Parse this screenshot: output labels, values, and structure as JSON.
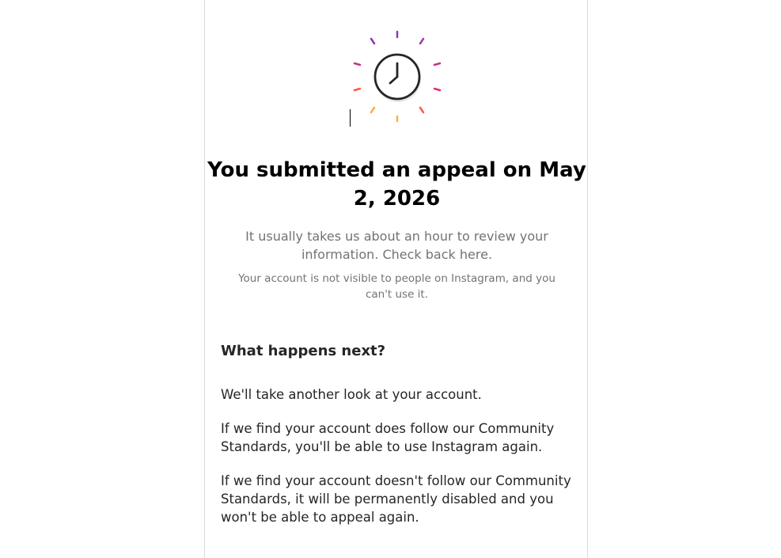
{
  "status": {
    "title": "You submitted an appeal on May 2, 2026",
    "review_note": "It usually takes us about an hour to review your information. Check back here.",
    "visibility_note": "Your account is not visible to people on Instagram, and you can't use it."
  },
  "next": {
    "heading": "What happens next?",
    "paragraphs": [
      "We'll take another look at your account.",
      "If we find your account does follow our Community Standards, you'll be able to use Instagram again.",
      "If we find your account doesn't follow our Community Standards, it will be permanently disabled and you won't be able to appeal again."
    ]
  },
  "icon": "clock-icon",
  "colors": {
    "clock_stroke": "#262626",
    "ray_purple": "#8a3ab9",
    "ray_magenta": "#c13584",
    "ray_pink": "#e1306c",
    "ray_orange": "#fd5949",
    "ray_yellow": "#fcaf45"
  }
}
